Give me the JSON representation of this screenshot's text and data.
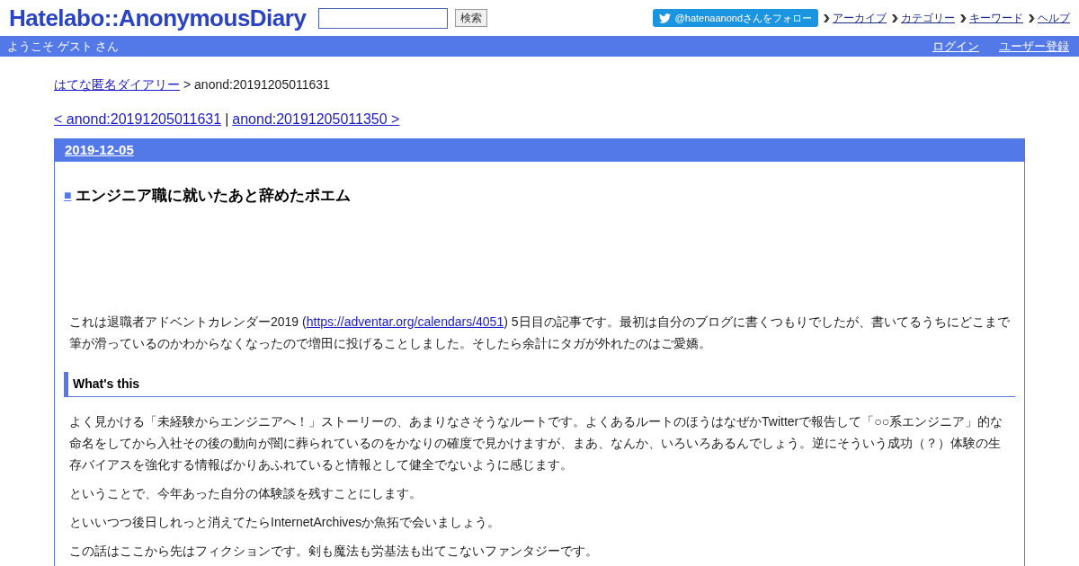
{
  "header": {
    "logo": "Hatelabo::AnonymousDiary",
    "search": {
      "button": "検索"
    },
    "follow_button": "@hatenaanondさんをフォロー",
    "links": [
      "アーカイブ",
      "カテゴリー",
      "キーワード",
      "ヘルプ"
    ]
  },
  "user_bar": {
    "welcome": "ようこそ ゲスト さん",
    "links": [
      "ログイン",
      "ユーザー登録"
    ]
  },
  "breadcrumb": {
    "link": "はてな匿名ダイアリー",
    "current": "> anond:20191205011631"
  },
  "pager": {
    "prev": "< anond:20191205011631",
    "separator": "|",
    "next": "anond:20191205011350 >"
  },
  "entry": {
    "date": "2019-12-05",
    "title_mark": "■",
    "title": "エンジニア職に就いたあと辞めたポエム",
    "intro": {
      "before": "これは退職者アドベントカレンダー2019 (",
      "link": "https://adventar.org/calendars/4051",
      "after": ") 5日目の記事です。最初は自分のブログに書くつもりでしたが、書いてるうちにどこまで筆が滑っているのかわからなくなったので増田に投げることしました。そしたら余計にタガが外れたのはご愛嬌。"
    },
    "section_heading": "What's this",
    "paragraphs": [
      "よく見かける「未経験からエンジニアへ！」ストーリーの、あまりなさそうなルートです。よくあるルートのほうはなぜかTwitterで報告して「○○系エンジニア」的な命名をしてから入社その後の動向が闇に葬られているのをかなりの確度で見かけますが、まあ、なんか、いろいろあるんでしょう。逆にそういう成功（？）体験の生存バイアスを強化する情報ばかりあふれていると情報として健全でないように感じます。",
      "ということで、今年あった自分の体験談を残すことにします。",
      "といいつつ後日しれっと消えてたらInternetArchivesか魚拓で会いましょう。",
      "この話はここから先はフィクションです。剣も魔法も労基法も出てこないファンタジーです。"
    ]
  }
}
